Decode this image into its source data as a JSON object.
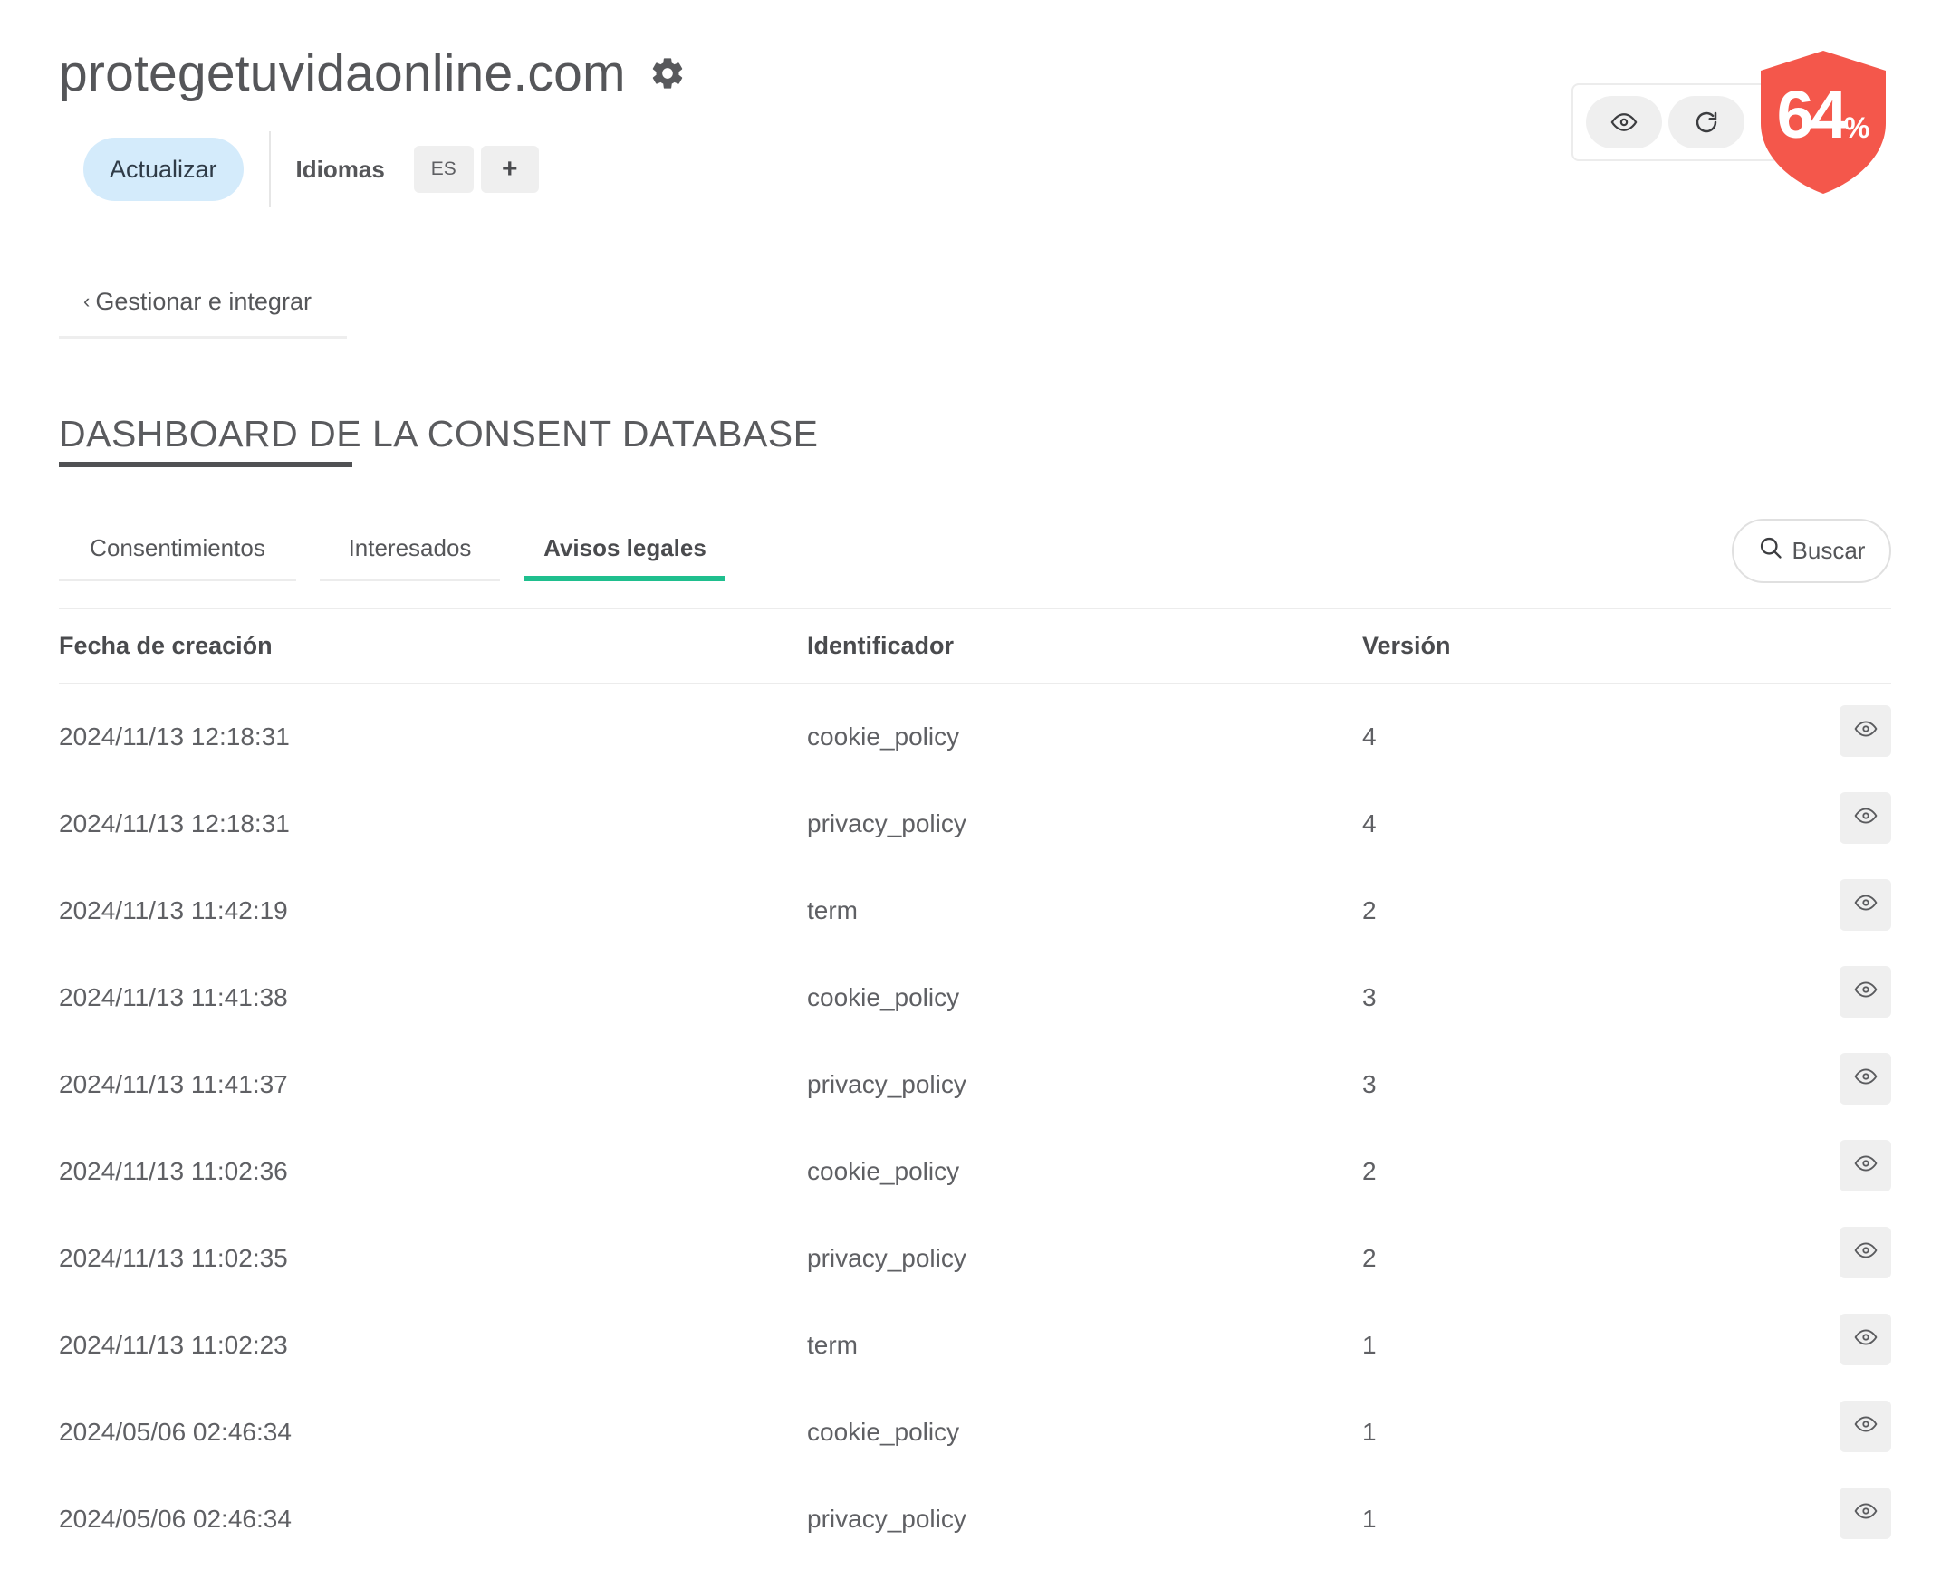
{
  "header": {
    "site_name": "protegetuvidaonline.com",
    "update_label": "Actualizar",
    "languages_label": "Idiomas",
    "language_chip": "ES",
    "add_language_label": "+"
  },
  "score": {
    "value": "64",
    "unit": "%",
    "color": "#f4574b"
  },
  "nav": {
    "back_label": "Gestionar e integrar"
  },
  "section": {
    "title": "DASHBOARD DE LA CONSENT DATABASE"
  },
  "tabs": [
    {
      "label": "Consentimientos",
      "active": false
    },
    {
      "label": "Interesados",
      "active": false
    },
    {
      "label": "Avisos legales",
      "active": true
    }
  ],
  "search": {
    "label": "Buscar"
  },
  "table": {
    "columns": [
      "Fecha de creación",
      "Identificador",
      "Versión"
    ],
    "rows": [
      {
        "date": "2024/11/13 12:18:31",
        "id": "cookie_policy",
        "version": "4"
      },
      {
        "date": "2024/11/13 12:18:31",
        "id": "privacy_policy",
        "version": "4"
      },
      {
        "date": "2024/11/13 11:42:19",
        "id": "term",
        "version": "2"
      },
      {
        "date": "2024/11/13 11:41:38",
        "id": "cookie_policy",
        "version": "3"
      },
      {
        "date": "2024/11/13 11:41:37",
        "id": "privacy_policy",
        "version": "3"
      },
      {
        "date": "2024/11/13 11:02:36",
        "id": "cookie_policy",
        "version": "2"
      },
      {
        "date": "2024/11/13 11:02:35",
        "id": "privacy_policy",
        "version": "2"
      },
      {
        "date": "2024/11/13 11:02:23",
        "id": "term",
        "version": "1"
      },
      {
        "date": "2024/05/06 02:46:34",
        "id": "cookie_policy",
        "version": "1"
      },
      {
        "date": "2024/05/06 02:46:34",
        "id": "privacy_policy",
        "version": "1"
      }
    ]
  },
  "colors": {
    "accent_tab": "#1fbf8e",
    "update_button_bg": "#d4ebfb",
    "text": "#555659"
  }
}
